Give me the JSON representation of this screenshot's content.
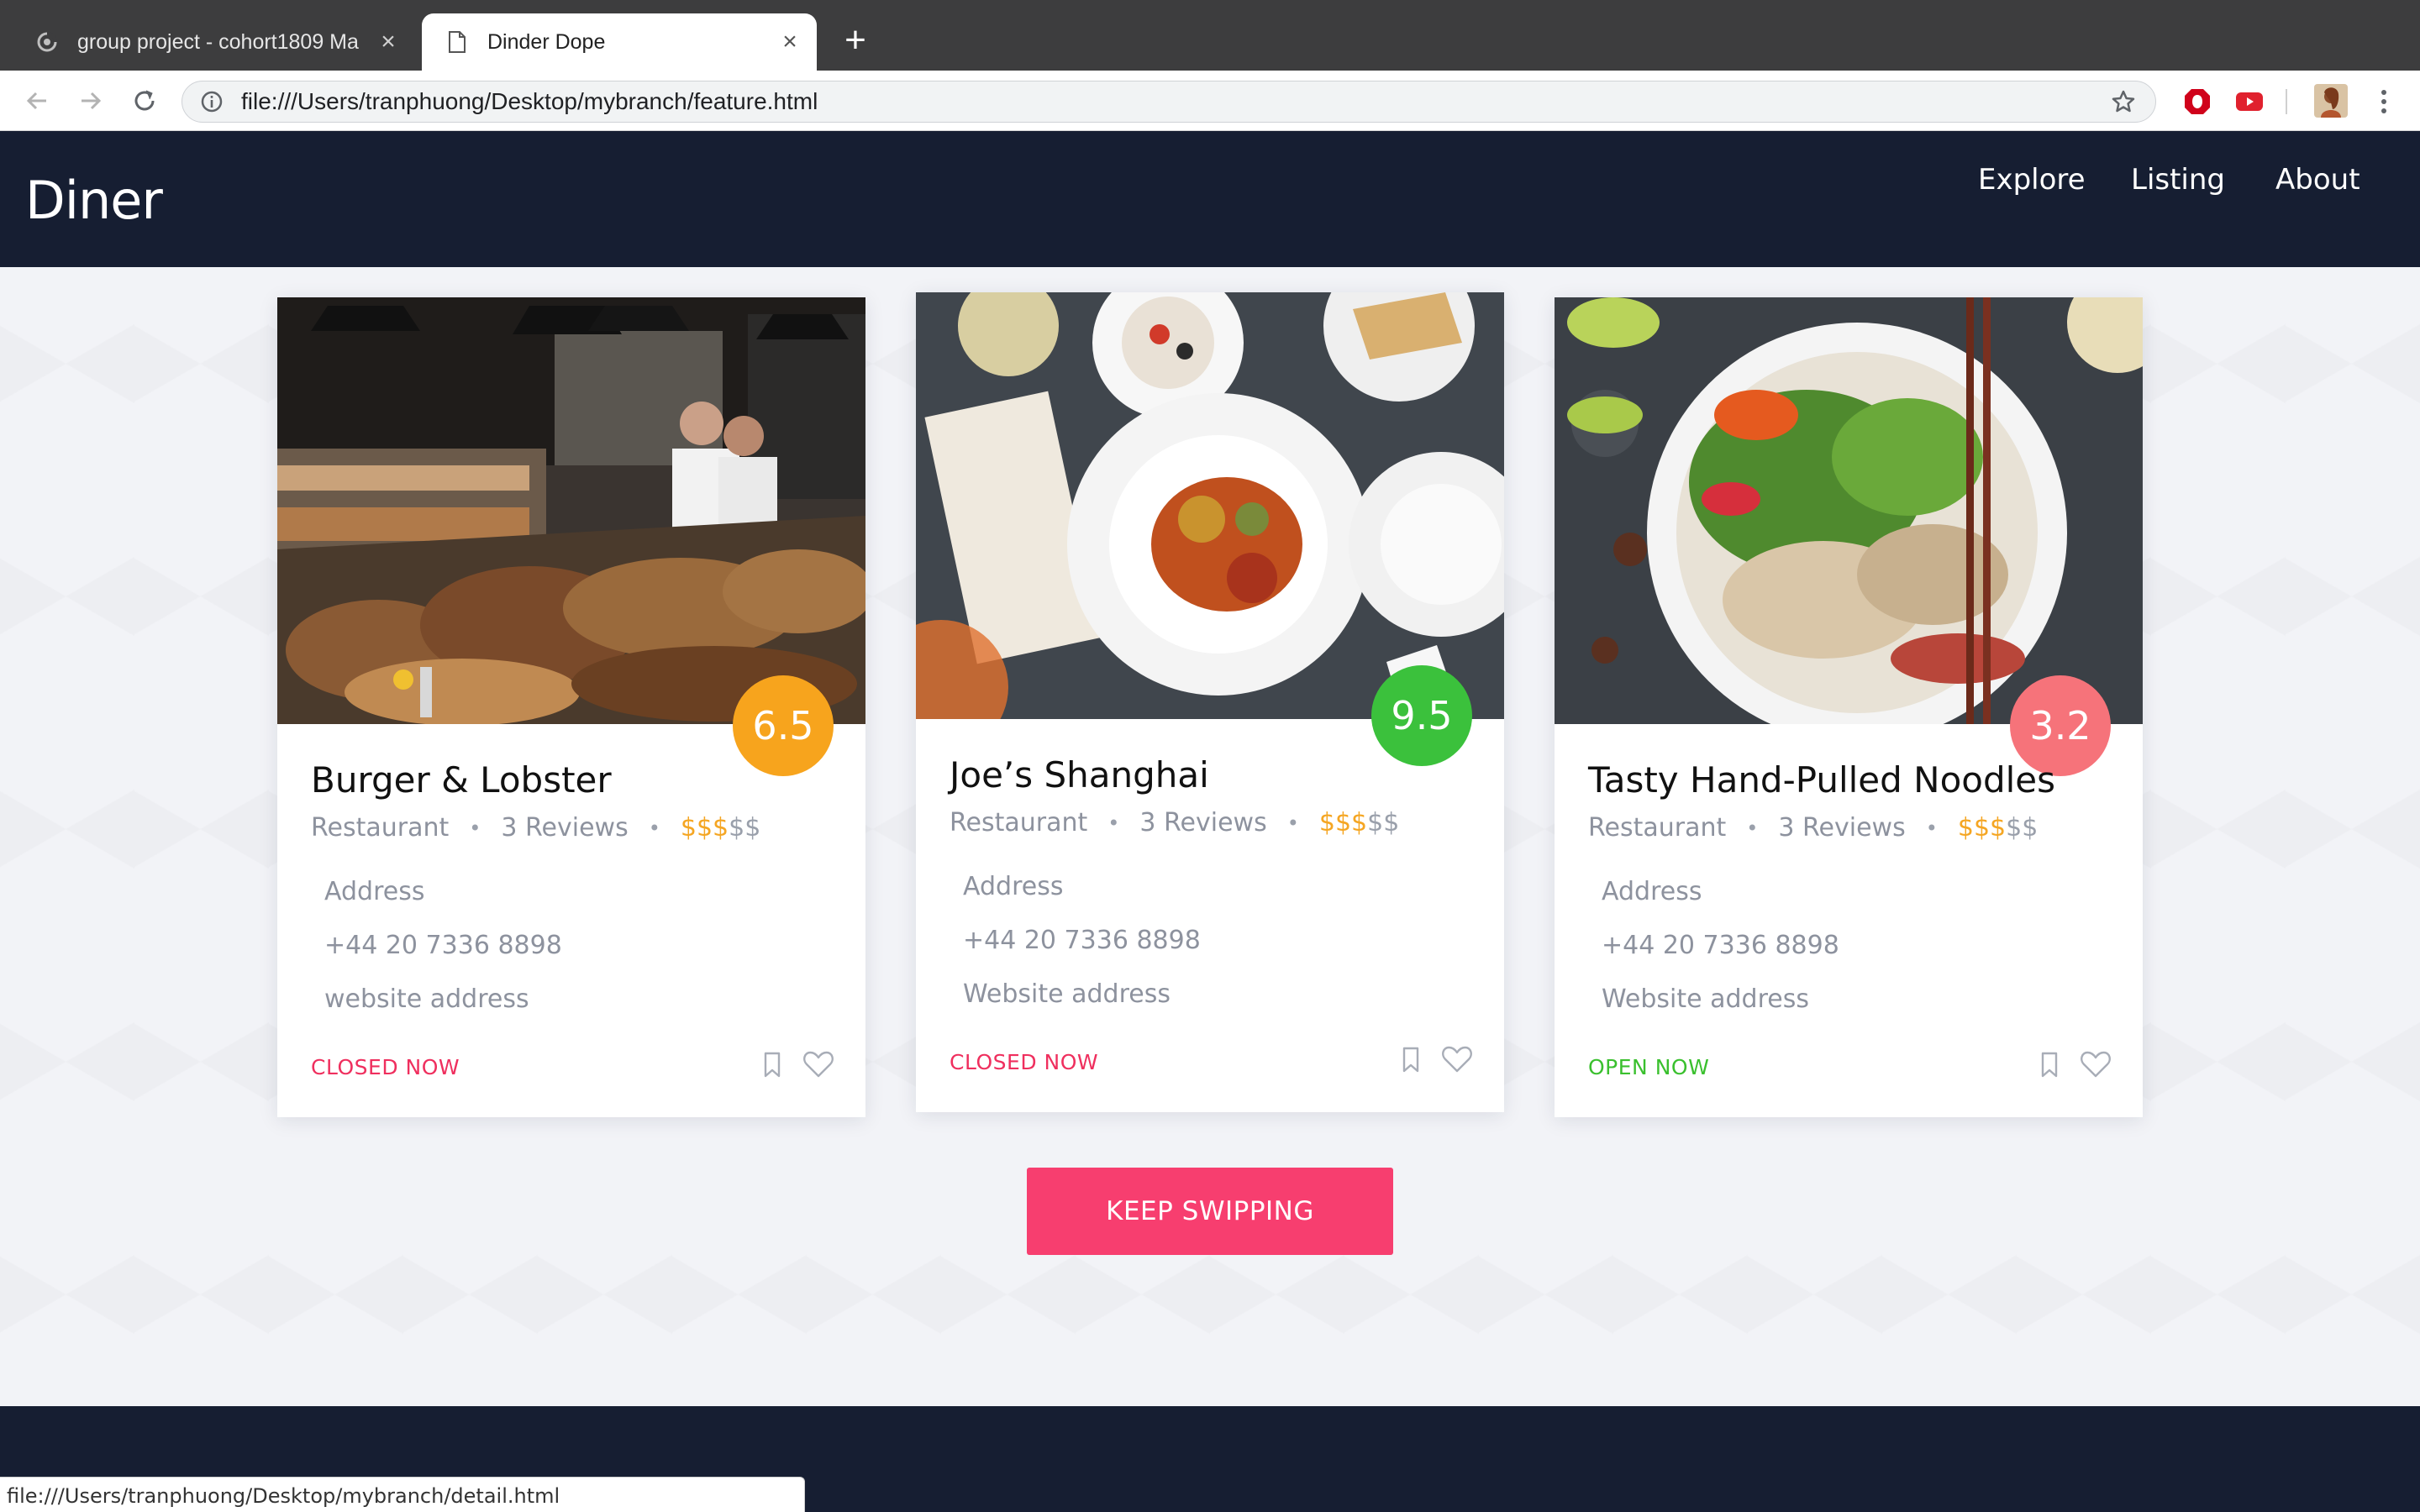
{
  "browser": {
    "tabs": [
      {
        "title": "group project - cohort1809 Ma",
        "icon": "loading-spinner-icon",
        "active": false
      },
      {
        "title": "Dinder Dope",
        "icon": "document-icon",
        "active": true
      }
    ],
    "new_tab_label": "+",
    "close_glyph": "×",
    "url": "file:///Users/tranphuong/Desktop/mybranch/feature.html",
    "status_url": "file:///Users/tranphuong/Desktop/mybranch/detail.html"
  },
  "site": {
    "brand": "Diner",
    "nav": [
      "Explore",
      "Listing",
      "About"
    ],
    "cards": [
      {
        "name": "Burger & Lobster",
        "score": "6.5",
        "score_color": "#f7a41d",
        "category": "Restaurant",
        "reviews": "3 Reviews",
        "price_on": "$$$",
        "price_off": "$$",
        "address": "Address",
        "phone": "+44 20 7336 8898",
        "website": "website address",
        "status": "CLOSED NOW",
        "status_type": "closed",
        "image": "bakery-photo"
      },
      {
        "name": "Joe’s Shanghai",
        "score": "9.5",
        "score_color": "#3bc13c",
        "category": "Restaurant",
        "reviews": "3 Reviews",
        "price_on": "$$$",
        "price_off": "$$",
        "address": "Address",
        "phone": "+44 20 7336 8898",
        "website": "Website address",
        "status": "CLOSED NOW",
        "status_type": "closed",
        "image": "dinner-table-photo"
      },
      {
        "name": "Tasty Hand-Pulled Noodles",
        "score": "3.2",
        "score_color": "#f6737a",
        "category": "Restaurant",
        "reviews": "3 Reviews",
        "price_on": "$$$",
        "price_off": "$$",
        "address": "Address",
        "phone": "+44 20 7336 8898",
        "website": "Website address",
        "status": "OPEN NOW",
        "status_type": "open",
        "image": "noodle-bowl-photo"
      }
    ],
    "cta": "KEEP SWIPPING",
    "separator_dot": "•"
  }
}
